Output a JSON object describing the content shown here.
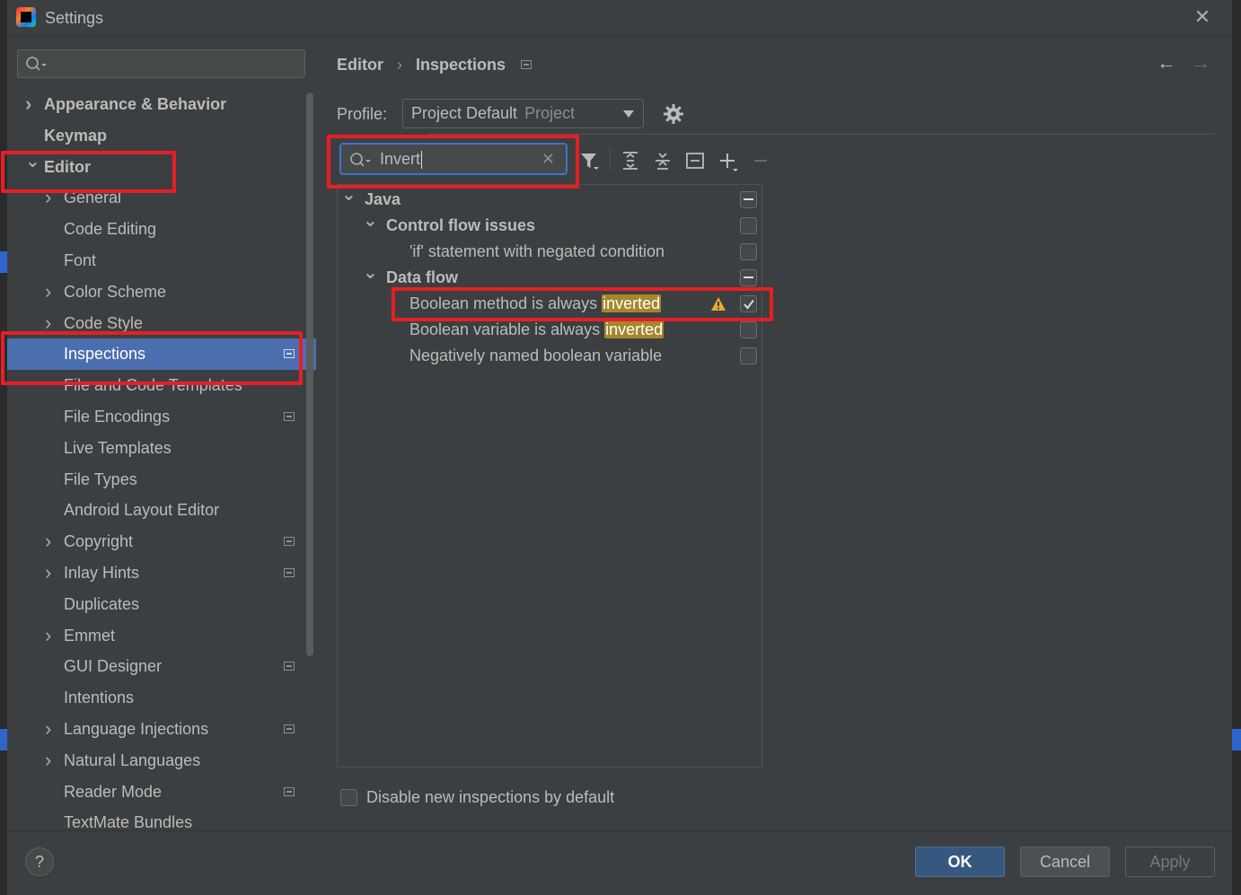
{
  "window": {
    "title": "Settings"
  },
  "sidebar": {
    "search_placeholder": "",
    "items": [
      {
        "label": "Appearance & Behavior",
        "level": 0,
        "bold": true,
        "chevron": "right",
        "project": false
      },
      {
        "label": "Keymap",
        "level": 0,
        "bold": true,
        "chevron": "",
        "project": false
      },
      {
        "label": "Editor",
        "level": 0,
        "bold": true,
        "chevron": "down",
        "project": false
      },
      {
        "label": "General",
        "level": 1,
        "bold": false,
        "chevron": "right",
        "project": false
      },
      {
        "label": "Code Editing",
        "level": 1,
        "bold": false,
        "chevron": "",
        "project": false
      },
      {
        "label": "Font",
        "level": 1,
        "bold": false,
        "chevron": "",
        "project": false
      },
      {
        "label": "Color Scheme",
        "level": 1,
        "bold": false,
        "chevron": "right",
        "project": false
      },
      {
        "label": "Code Style",
        "level": 1,
        "bold": false,
        "chevron": "right",
        "project": false
      },
      {
        "label": "Inspections",
        "level": 1,
        "bold": false,
        "chevron": "",
        "project": true,
        "selected": true
      },
      {
        "label": "File and Code Templates",
        "level": 1,
        "bold": false,
        "chevron": "",
        "project": false
      },
      {
        "label": "File Encodings",
        "level": 1,
        "bold": false,
        "chevron": "",
        "project": true
      },
      {
        "label": "Live Templates",
        "level": 1,
        "bold": false,
        "chevron": "",
        "project": false
      },
      {
        "label": "File Types",
        "level": 1,
        "bold": false,
        "chevron": "",
        "project": false
      },
      {
        "label": "Android Layout Editor",
        "level": 1,
        "bold": false,
        "chevron": "",
        "project": false
      },
      {
        "label": "Copyright",
        "level": 1,
        "bold": false,
        "chevron": "right",
        "project": true
      },
      {
        "label": "Inlay Hints",
        "level": 1,
        "bold": false,
        "chevron": "right",
        "project": true
      },
      {
        "label": "Duplicates",
        "level": 1,
        "bold": false,
        "chevron": "",
        "project": false
      },
      {
        "label": "Emmet",
        "level": 1,
        "bold": false,
        "chevron": "right",
        "project": false
      },
      {
        "label": "GUI Designer",
        "level": 1,
        "bold": false,
        "chevron": "",
        "project": true
      },
      {
        "label": "Intentions",
        "level": 1,
        "bold": false,
        "chevron": "",
        "project": false
      },
      {
        "label": "Language Injections",
        "level": 1,
        "bold": false,
        "chevron": "right",
        "project": true
      },
      {
        "label": "Natural Languages",
        "level": 1,
        "bold": false,
        "chevron": "right",
        "project": false
      },
      {
        "label": "Reader Mode",
        "level": 1,
        "bold": false,
        "chevron": "",
        "project": true
      },
      {
        "label": "TextMate Bundles",
        "level": 1,
        "bold": false,
        "chevron": "",
        "project": false
      }
    ]
  },
  "main": {
    "breadcrumb": {
      "parent": "Editor",
      "separator": "›",
      "current": "Inspections"
    },
    "profile": {
      "label": "Profile:",
      "value": "Project Default",
      "scope": "Project"
    },
    "filter": {
      "value": "Invert"
    },
    "inspections": [
      {
        "label": "Java",
        "indent": 0,
        "bold": true,
        "chevron": "down",
        "state": "mixed",
        "highlight": "",
        "warning": false
      },
      {
        "label": "Control flow issues",
        "indent": 1,
        "bold": true,
        "chevron": "down",
        "state": "off",
        "highlight": "",
        "warning": false
      },
      {
        "label": "'if' statement with negated condition",
        "indent": 2,
        "bold": false,
        "chevron": "",
        "state": "off",
        "highlight": "",
        "warning": false
      },
      {
        "label": "Data flow",
        "indent": 1,
        "bold": true,
        "chevron": "down",
        "state": "mixed",
        "highlight": "",
        "warning": false
      },
      {
        "label": "Boolean method is always ",
        "indent": 2,
        "bold": false,
        "chevron": "",
        "state": "checked",
        "highlight": "inverted",
        "warning": true
      },
      {
        "label": "Boolean variable is always ",
        "indent": 2,
        "bold": false,
        "chevron": "",
        "state": "off",
        "highlight": "inverted",
        "warning": false
      },
      {
        "label": "Negatively named boolean variable",
        "indent": 2,
        "bold": false,
        "chevron": "",
        "state": "off",
        "highlight": "",
        "warning": false
      }
    ],
    "disable_new_label": "Disable new inspections by default"
  },
  "footer": {
    "help": "?",
    "ok": "OK",
    "cancel": "Cancel",
    "apply": "Apply"
  },
  "colors": {
    "background": "#3c3f41",
    "selection": "#4b6eaf",
    "highlight": "#a5872c",
    "annotation": "#e81e25",
    "ok_button": "#365880"
  }
}
